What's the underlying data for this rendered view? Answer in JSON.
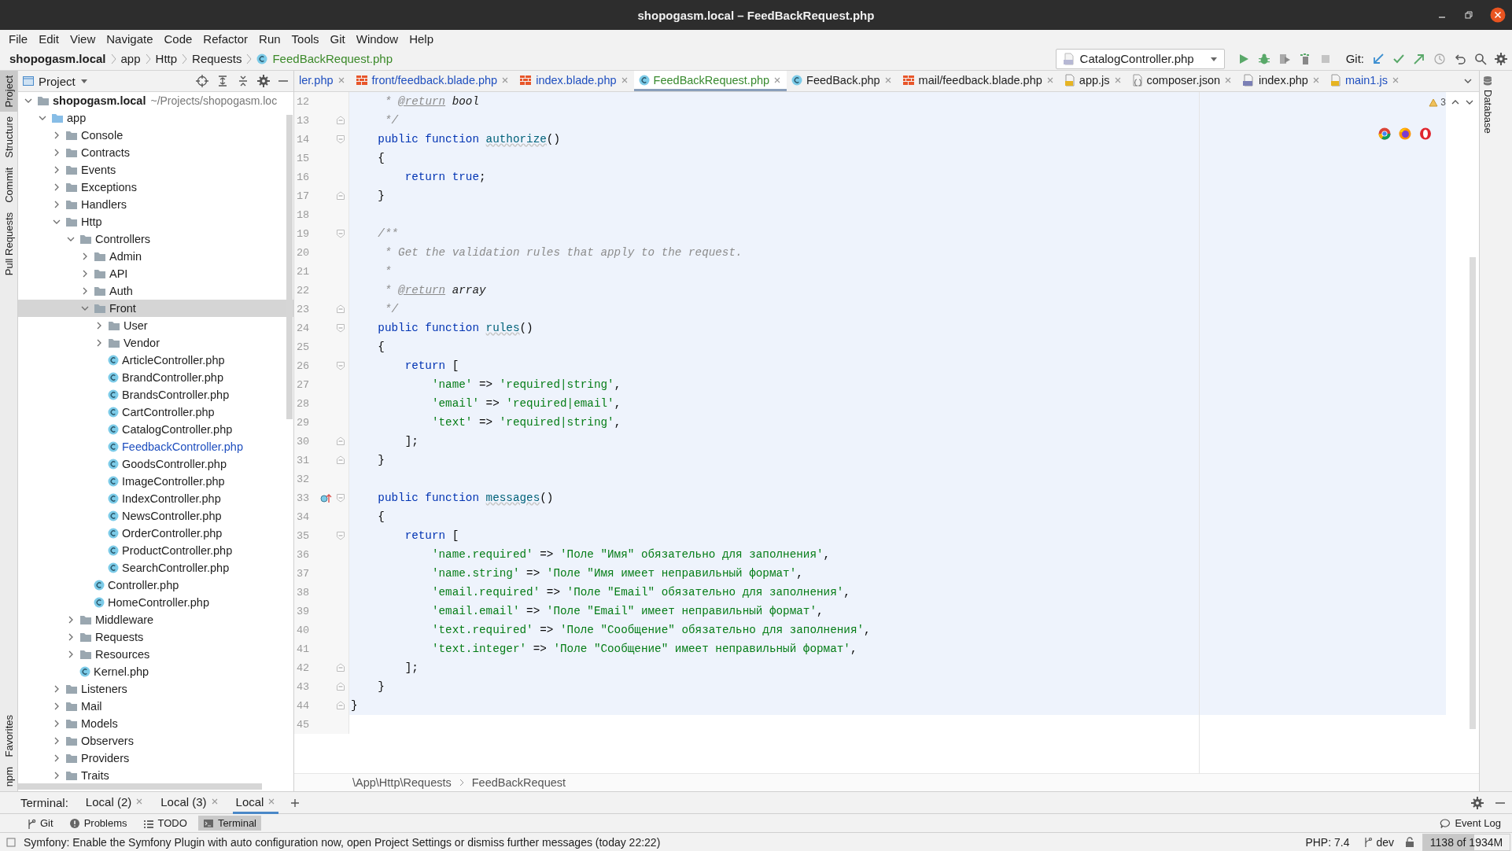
{
  "window": {
    "title": "shopogasm.local – FeedBackRequest.php"
  },
  "menu": [
    "File",
    "Edit",
    "View",
    "Navigate",
    "Code",
    "Refactor",
    "Run",
    "Tools",
    "Git",
    "Window",
    "Help"
  ],
  "nav_bar": {
    "breadcrumbs": [
      {
        "label": "shopogasm.local",
        "kind": "project"
      },
      {
        "label": "app",
        "kind": "dir"
      },
      {
        "label": "Http",
        "kind": "dir"
      },
      {
        "label": "Requests",
        "kind": "dir"
      },
      {
        "label": "FeedBackRequest.php",
        "kind": "class"
      }
    ],
    "run_config": "CatalogController.php",
    "git_label": "Git:"
  },
  "left_toolbar": {
    "top": [
      {
        "label": "Project",
        "selected": true
      },
      {
        "label": "Structure",
        "selected": false
      },
      {
        "label": "Commit",
        "selected": false
      },
      {
        "label": "Pull Requests",
        "selected": false
      }
    ],
    "bottom": [
      {
        "label": "Favorites",
        "selected": false
      },
      {
        "label": "npm",
        "selected": false
      }
    ]
  },
  "right_toolbar": [
    {
      "label": "Database",
      "selected": false
    }
  ],
  "project_panel": {
    "title": "Project",
    "tree": [
      {
        "label": "shopogasm.local",
        "kind": "project",
        "note": "~/Projects/shopogasm.loc",
        "expanded": true,
        "selected": false,
        "color": "#1e1e1e",
        "children": [
          {
            "label": "app",
            "kind": "source",
            "expanded": true,
            "selected": false,
            "color": "#1e1e1e",
            "children": [
              {
                "label": "Console",
                "kind": "folder",
                "expanded": false,
                "selected": false,
                "color": "#1e1e1e"
              },
              {
                "label": "Contracts",
                "kind": "folder",
                "expanded": false,
                "selected": false,
                "color": "#1e1e1e"
              },
              {
                "label": "Events",
                "kind": "folder",
                "expanded": false,
                "selected": false,
                "color": "#1e1e1e"
              },
              {
                "label": "Exceptions",
                "kind": "folder",
                "expanded": false,
                "selected": false,
                "color": "#1e1e1e"
              },
              {
                "label": "Handlers",
                "kind": "folder",
                "expanded": false,
                "selected": false,
                "color": "#1e1e1e"
              },
              {
                "label": "Http",
                "kind": "folder",
                "expanded": true,
                "selected": false,
                "color": "#1e1e1e",
                "children": [
                  {
                    "label": "Controllers",
                    "kind": "folder",
                    "expanded": true,
                    "selected": false,
                    "color": "#1e1e1e",
                    "children": [
                      {
                        "label": "Admin",
                        "kind": "folder",
                        "expanded": false,
                        "selected": false,
                        "color": "#1e1e1e"
                      },
                      {
                        "label": "API",
                        "kind": "folder",
                        "expanded": false,
                        "selected": false,
                        "color": "#1e1e1e"
                      },
                      {
                        "label": "Auth",
                        "kind": "folder",
                        "expanded": false,
                        "selected": false,
                        "color": "#1e1e1e"
                      },
                      {
                        "label": "Front",
                        "kind": "folder",
                        "expanded": true,
                        "selected": true,
                        "color": "#1e1e1e",
                        "children": [
                          {
                            "label": "User",
                            "kind": "folder",
                            "expanded": false,
                            "selected": false,
                            "color": "#1e1e1e"
                          },
                          {
                            "label": "Vendor",
                            "kind": "folder",
                            "expanded": false,
                            "selected": false,
                            "color": "#1e1e1e"
                          },
                          {
                            "label": "ArticleController.php",
                            "kind": "class",
                            "selected": false,
                            "color": "#1e1e1e"
                          },
                          {
                            "label": "BrandController.php",
                            "kind": "class",
                            "selected": false,
                            "color": "#1e1e1e"
                          },
                          {
                            "label": "BrandsController.php",
                            "kind": "class",
                            "selected": false,
                            "color": "#1e1e1e"
                          },
                          {
                            "label": "CartController.php",
                            "kind": "class",
                            "selected": false,
                            "color": "#1e1e1e"
                          },
                          {
                            "label": "CatalogController.php",
                            "kind": "class",
                            "selected": false,
                            "color": "#1e1e1e"
                          },
                          {
                            "label": "FeedbackController.php",
                            "kind": "class",
                            "selected": false,
                            "color": "#1f4fbf"
                          },
                          {
                            "label": "GoodsController.php",
                            "kind": "class",
                            "selected": false,
                            "color": "#1e1e1e"
                          },
                          {
                            "label": "ImageController.php",
                            "kind": "class",
                            "selected": false,
                            "color": "#1e1e1e"
                          },
                          {
                            "label": "IndexController.php",
                            "kind": "class",
                            "selected": false,
                            "color": "#1e1e1e"
                          },
                          {
                            "label": "NewsController.php",
                            "kind": "class",
                            "selected": false,
                            "color": "#1e1e1e"
                          },
                          {
                            "label": "OrderController.php",
                            "kind": "class",
                            "selected": false,
                            "color": "#1e1e1e"
                          },
                          {
                            "label": "ProductController.php",
                            "kind": "class",
                            "selected": false,
                            "color": "#1e1e1e"
                          },
                          {
                            "label": "SearchController.php",
                            "kind": "class",
                            "selected": false,
                            "color": "#1e1e1e"
                          }
                        ]
                      },
                      {
                        "label": "Controller.php",
                        "kind": "class",
                        "selected": false,
                        "color": "#1e1e1e"
                      },
                      {
                        "label": "HomeController.php",
                        "kind": "class",
                        "selected": false,
                        "color": "#1e1e1e"
                      }
                    ]
                  },
                  {
                    "label": "Middleware",
                    "kind": "folder",
                    "expanded": false,
                    "selected": false,
                    "color": "#1e1e1e"
                  },
                  {
                    "label": "Requests",
                    "kind": "folder",
                    "expanded": false,
                    "selected": false,
                    "color": "#1e1e1e"
                  },
                  {
                    "label": "Resources",
                    "kind": "folder",
                    "expanded": false,
                    "selected": false,
                    "color": "#1e1e1e"
                  },
                  {
                    "label": "Kernel.php",
                    "kind": "class",
                    "selected": false,
                    "color": "#1e1e1e"
                  }
                ]
              },
              {
                "label": "Listeners",
                "kind": "folder",
                "expanded": false,
                "selected": false,
                "color": "#1e1e1e"
              },
              {
                "label": "Mail",
                "kind": "folder",
                "expanded": false,
                "selected": false,
                "color": "#1e1e1e"
              },
              {
                "label": "Models",
                "kind": "folder",
                "expanded": false,
                "selected": false,
                "color": "#1e1e1e"
              },
              {
                "label": "Observers",
                "kind": "folder",
                "expanded": false,
                "selected": false,
                "color": "#1e1e1e"
              },
              {
                "label": "Providers",
                "kind": "folder",
                "expanded": false,
                "selected": false,
                "color": "#1e1e1e"
              },
              {
                "label": "Traits",
                "kind": "folder",
                "expanded": false,
                "selected": false,
                "color": "#1e1e1e"
              }
            ]
          }
        ]
      }
    ]
  },
  "editor_tabs": [
    {
      "label": "ler.php",
      "kind": "none",
      "selected": false,
      "color": "#1f4fbf"
    },
    {
      "label": "front/feedback.blade.php",
      "kind": "blade",
      "selected": false,
      "color": "#1f4fbf"
    },
    {
      "label": "index.blade.php",
      "kind": "blade",
      "selected": false,
      "color": "#1f4fbf"
    },
    {
      "label": "FeedBackRequest.php",
      "kind": "class",
      "selected": true,
      "color": "#388a2e"
    },
    {
      "label": "FeedBack.php",
      "kind": "class",
      "selected": false,
      "color": "#1e1e1e"
    },
    {
      "label": "mail/feedback.blade.php",
      "kind": "blade",
      "selected": false,
      "color": "#1e1e1e"
    },
    {
      "label": "app.js",
      "kind": "js",
      "selected": false,
      "color": "#1e1e1e"
    },
    {
      "label": "composer.json",
      "kind": "json",
      "selected": false,
      "color": "#1e1e1e"
    },
    {
      "label": "index.php",
      "kind": "php",
      "selected": false,
      "color": "#1e1e1e"
    },
    {
      "label": "main1.js",
      "kind": "js",
      "selected": false,
      "color": "#1f4fbf"
    }
  ],
  "editor": {
    "warning_count": "3",
    "lines": [
      {
        "number": "12",
        "fold_start": false,
        "fold_end": false,
        "override": false,
        "highlighted": true,
        "tokens": [
          {
            "kind": "comment",
            "text": "     * "
          },
          {
            "kind": "doctag",
            "text": "@return"
          },
          {
            "kind": "doctype",
            "text": " bool"
          }
        ]
      },
      {
        "number": "13",
        "fold_start": false,
        "fold_end": true,
        "override": false,
        "highlighted": true,
        "tokens": [
          {
            "kind": "comment",
            "text": "     */"
          }
        ]
      },
      {
        "number": "14",
        "fold_start": true,
        "fold_end": false,
        "override": false,
        "highlighted": true,
        "tokens": [
          {
            "kind": "keyword",
            "text": "    public function "
          },
          {
            "kind": "function",
            "text": "authorize"
          },
          {
            "kind": "plain",
            "text": "()"
          }
        ]
      },
      {
        "number": "15",
        "fold_start": false,
        "fold_end": false,
        "override": false,
        "highlighted": true,
        "tokens": [
          {
            "kind": "plain",
            "text": "    {"
          }
        ]
      },
      {
        "number": "16",
        "fold_start": false,
        "fold_end": false,
        "override": false,
        "highlighted": true,
        "tokens": [
          {
            "kind": "keyword",
            "text": "        return true"
          },
          {
            "kind": "plain",
            "text": ";"
          }
        ]
      },
      {
        "number": "17",
        "fold_start": false,
        "fold_end": true,
        "override": false,
        "highlighted": true,
        "tokens": [
          {
            "kind": "plain",
            "text": "    }"
          }
        ]
      },
      {
        "number": "18",
        "fold_start": false,
        "fold_end": false,
        "override": false,
        "highlighted": true
      },
      {
        "number": "19",
        "fold_start": true,
        "fold_end": false,
        "override": false,
        "highlighted": true,
        "tokens": [
          {
            "kind": "comment",
            "text": "    /**"
          }
        ]
      },
      {
        "number": "20",
        "fold_start": false,
        "fold_end": false,
        "override": false,
        "highlighted": true,
        "tokens": [
          {
            "kind": "comment",
            "text": "     * Get the validation rules that apply to the request."
          }
        ]
      },
      {
        "number": "21",
        "fold_start": false,
        "fold_end": false,
        "override": false,
        "highlighted": true,
        "tokens": [
          {
            "kind": "comment",
            "text": "     *"
          }
        ]
      },
      {
        "number": "22",
        "fold_start": false,
        "fold_end": false,
        "override": false,
        "highlighted": true,
        "tokens": [
          {
            "kind": "comment",
            "text": "     * "
          },
          {
            "kind": "doctag",
            "text": "@return"
          },
          {
            "kind": "doctype",
            "text": " array"
          }
        ]
      },
      {
        "number": "23",
        "fold_start": false,
        "fold_end": true,
        "override": false,
        "highlighted": true,
        "tokens": [
          {
            "kind": "comment",
            "text": "     */"
          }
        ]
      },
      {
        "number": "24",
        "fold_start": true,
        "fold_end": false,
        "override": false,
        "highlighted": true,
        "tokens": [
          {
            "kind": "keyword",
            "text": "    public function "
          },
          {
            "kind": "function",
            "text": "rules"
          },
          {
            "kind": "plain",
            "text": "()"
          }
        ]
      },
      {
        "number": "25",
        "fold_start": false,
        "fold_end": false,
        "override": false,
        "highlighted": true,
        "tokens": [
          {
            "kind": "plain",
            "text": "    {"
          }
        ]
      },
      {
        "number": "26",
        "fold_start": true,
        "fold_end": false,
        "override": false,
        "highlighted": true,
        "tokens": [
          {
            "kind": "keyword",
            "text": "        return"
          },
          {
            "kind": "plain",
            "text": " ["
          }
        ]
      },
      {
        "number": "27",
        "fold_start": false,
        "fold_end": false,
        "override": false,
        "highlighted": true,
        "tokens": [
          {
            "kind": "string",
            "text": "            'name'"
          },
          {
            "kind": "plain",
            "text": " => "
          },
          {
            "kind": "string",
            "text": "'required|string'"
          },
          {
            "kind": "plain",
            "text": ","
          }
        ]
      },
      {
        "number": "28",
        "fold_start": false,
        "fold_end": false,
        "override": false,
        "highlighted": true,
        "tokens": [
          {
            "kind": "string",
            "text": "            'email'"
          },
          {
            "kind": "plain",
            "text": " => "
          },
          {
            "kind": "string",
            "text": "'required|email'"
          },
          {
            "kind": "plain",
            "text": ","
          }
        ]
      },
      {
        "number": "29",
        "fold_start": false,
        "fold_end": false,
        "override": false,
        "highlighted": true,
        "tokens": [
          {
            "kind": "string",
            "text": "            'text'"
          },
          {
            "kind": "plain",
            "text": " => "
          },
          {
            "kind": "string",
            "text": "'required|string'"
          },
          {
            "kind": "plain",
            "text": ","
          }
        ]
      },
      {
        "number": "30",
        "fold_start": false,
        "fold_end": true,
        "override": false,
        "highlighted": true,
        "tokens": [
          {
            "kind": "plain",
            "text": "        ];"
          }
        ]
      },
      {
        "number": "31",
        "fold_start": false,
        "fold_end": true,
        "override": false,
        "highlighted": true,
        "tokens": [
          {
            "kind": "plain",
            "text": "    }"
          }
        ]
      },
      {
        "number": "32",
        "fold_start": false,
        "fold_end": false,
        "override": false,
        "highlighted": true
      },
      {
        "number": "33",
        "fold_start": true,
        "fold_end": false,
        "override": true,
        "highlighted": true,
        "tokens": [
          {
            "kind": "keyword",
            "text": "    public function "
          },
          {
            "kind": "function",
            "text": "messages"
          },
          {
            "kind": "plain",
            "text": "()"
          }
        ]
      },
      {
        "number": "34",
        "fold_start": false,
        "fold_end": false,
        "override": false,
        "highlighted": true,
        "tokens": [
          {
            "kind": "plain",
            "text": "    {"
          }
        ]
      },
      {
        "number": "35",
        "fold_start": true,
        "fold_end": false,
        "override": false,
        "highlighted": true,
        "tokens": [
          {
            "kind": "keyword",
            "text": "        return"
          },
          {
            "kind": "plain",
            "text": " ["
          }
        ]
      },
      {
        "number": "36",
        "fold_start": false,
        "fold_end": false,
        "override": false,
        "highlighted": true,
        "tokens": [
          {
            "kind": "string",
            "text": "            'name.required'"
          },
          {
            "kind": "plain",
            "text": " => "
          },
          {
            "kind": "string",
            "text": "'Поле \"Имя\" обязательно для заполнения'"
          },
          {
            "kind": "plain",
            "text": ","
          }
        ]
      },
      {
        "number": "37",
        "fold_start": false,
        "fold_end": false,
        "override": false,
        "highlighted": true,
        "tokens": [
          {
            "kind": "string",
            "text": "            'name.string'"
          },
          {
            "kind": "plain",
            "text": " => "
          },
          {
            "kind": "string",
            "text": "'Поле \"Имя имеет неправильный формат'"
          },
          {
            "kind": "plain",
            "text": ","
          }
        ]
      },
      {
        "number": "38",
        "fold_start": false,
        "fold_end": false,
        "override": false,
        "highlighted": true,
        "tokens": [
          {
            "kind": "string",
            "text": "            'email.required'"
          },
          {
            "kind": "plain",
            "text": " => "
          },
          {
            "kind": "string",
            "text": "'Поле \"Email\" обязательно для заполнения'"
          },
          {
            "kind": "plain",
            "text": ","
          }
        ]
      },
      {
        "number": "39",
        "fold_start": false,
        "fold_end": false,
        "override": false,
        "highlighted": true,
        "tokens": [
          {
            "kind": "string",
            "text": "            'email.email'"
          },
          {
            "kind": "plain",
            "text": " => "
          },
          {
            "kind": "string",
            "text": "'Поле \"Email\" имеет неправильный формат'"
          },
          {
            "kind": "plain",
            "text": ","
          }
        ]
      },
      {
        "number": "40",
        "fold_start": false,
        "fold_end": false,
        "override": false,
        "highlighted": true,
        "tokens": [
          {
            "kind": "string",
            "text": "            'text.required'"
          },
          {
            "kind": "plain",
            "text": " => "
          },
          {
            "kind": "string",
            "text": "'Поле \"Сообщение\" обязательно для заполнения'"
          },
          {
            "kind": "plain",
            "text": ","
          }
        ]
      },
      {
        "number": "41",
        "fold_start": false,
        "fold_end": false,
        "override": false,
        "highlighted": true,
        "tokens": [
          {
            "kind": "string",
            "text": "            'text.integer'"
          },
          {
            "kind": "plain",
            "text": " => "
          },
          {
            "kind": "string",
            "text": "'Поле \"Сообщение\" имеет неправильный формат'"
          },
          {
            "kind": "plain",
            "text": ","
          }
        ]
      },
      {
        "number": "42",
        "fold_start": false,
        "fold_end": true,
        "override": false,
        "highlighted": true,
        "tokens": [
          {
            "kind": "plain",
            "text": "        ];"
          }
        ]
      },
      {
        "number": "43",
        "fold_start": false,
        "fold_end": true,
        "override": false,
        "highlighted": true,
        "tokens": [
          {
            "kind": "plain",
            "text": "    }"
          }
        ]
      },
      {
        "number": "44",
        "fold_start": false,
        "fold_end": true,
        "override": false,
        "highlighted": true,
        "tokens": [
          {
            "kind": "plain",
            "text": "}"
          }
        ]
      },
      {
        "number": "45",
        "fold_start": false,
        "fold_end": false,
        "override": false,
        "highlighted": false
      }
    ],
    "breadcrumbs": [
      "\\App\\Http\\Requests",
      "FeedBackRequest"
    ]
  },
  "terminal_bar": {
    "label": "Terminal:",
    "tabs": [
      {
        "label": "Local (2)",
        "selected": false
      },
      {
        "label": "Local (3)",
        "selected": false
      },
      {
        "label": "Local",
        "selected": true
      }
    ]
  },
  "tool_strip": {
    "items": [
      {
        "label": "Git",
        "kind": "git",
        "selected": false
      },
      {
        "label": "Problems",
        "kind": "problems",
        "selected": false
      },
      {
        "label": "TODO",
        "kind": "todo",
        "selected": false
      },
      {
        "label": "Terminal",
        "kind": "terminal",
        "selected": true
      }
    ],
    "event_log": "Event Log"
  },
  "status_bar": {
    "message": "Symfony: Enable the Symfony Plugin with auto configuration now, open Project Settings or dismiss further messages (today 22:22)",
    "php": "PHP: 7.4",
    "branch": "dev",
    "memory": {
      "text": "1138 of 1934M",
      "level": 0.59
    }
  }
}
